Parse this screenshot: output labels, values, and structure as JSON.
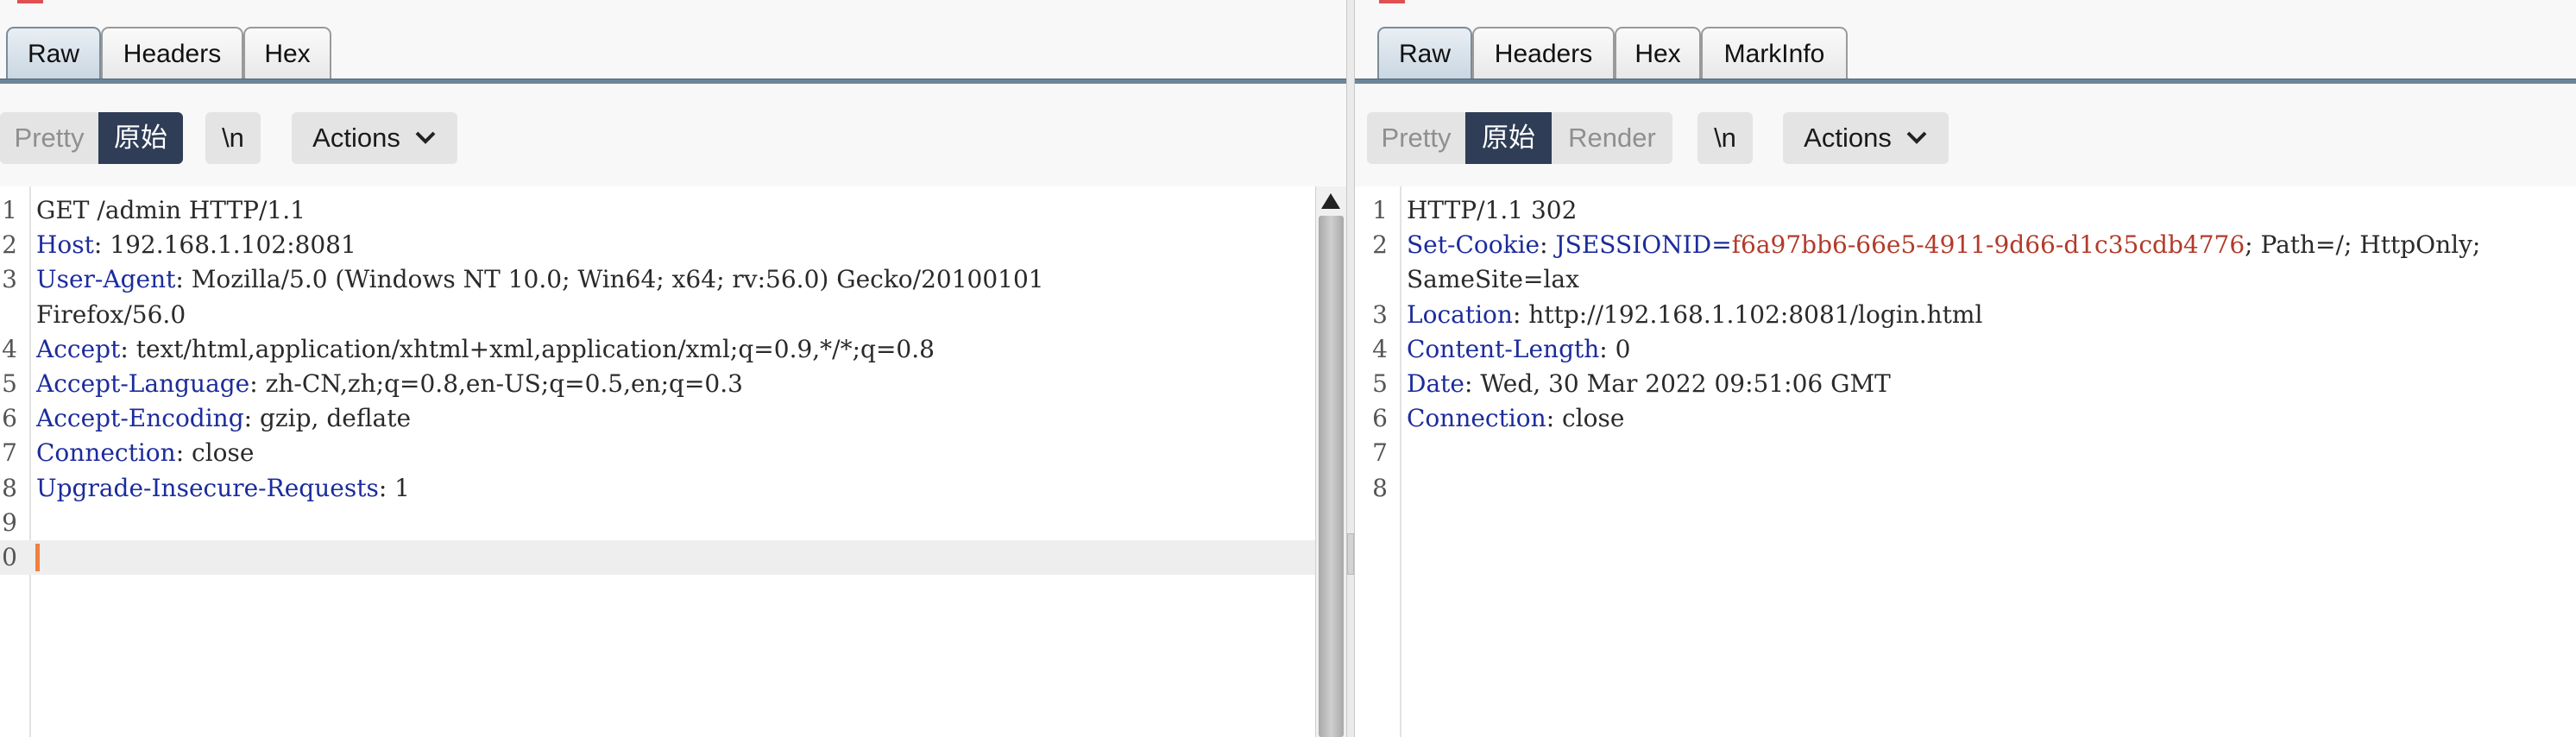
{
  "request": {
    "tabs": [
      {
        "label": "Raw",
        "active": true
      },
      {
        "label": "Headers",
        "active": false
      },
      {
        "label": "Hex",
        "active": false
      }
    ],
    "view_modes": [
      {
        "label": "Pretty",
        "active": false
      },
      {
        "label": "原始",
        "active": true
      }
    ],
    "newline_label": "\\n",
    "actions_label": "Actions",
    "lines": [
      {
        "num": "1",
        "key": "",
        "sep": "",
        "value": "GET /admin HTTP/1.1"
      },
      {
        "num": "2",
        "key": "Host",
        "sep": ": ",
        "value": "192.168.1.102:8081"
      },
      {
        "num": "3",
        "key": "User-Agent",
        "sep": ": ",
        "value": "Mozilla/5.0 (Windows NT 10.0; Win64; x64; rv:56.0) Gecko/20100101"
      },
      {
        "num": "",
        "key": "",
        "sep": "",
        "value": "Firefox/56.0"
      },
      {
        "num": "4",
        "key": "Accept",
        "sep": ": ",
        "value": "text/html,application/xhtml+xml,application/xml;q=0.9,*/*;q=0.8"
      },
      {
        "num": "5",
        "key": "Accept-Language",
        "sep": ": ",
        "value": "zh-CN,zh;q=0.8,en-US;q=0.5,en;q=0.3"
      },
      {
        "num": "6",
        "key": "Accept-Encoding",
        "sep": ": ",
        "value": "gzip, deflate"
      },
      {
        "num": "7",
        "key": "Connection",
        "sep": ": ",
        "value": "close"
      },
      {
        "num": "8",
        "key": "Upgrade-Insecure-Requests",
        "sep": ": ",
        "value": "1"
      },
      {
        "num": "9",
        "key": "",
        "sep": "",
        "value": ""
      },
      {
        "num": "0",
        "key": "",
        "sep": "",
        "value": ""
      }
    ]
  },
  "response": {
    "tabs": [
      {
        "label": "Raw",
        "active": true
      },
      {
        "label": "Headers",
        "active": false
      },
      {
        "label": "Hex",
        "active": false
      },
      {
        "label": "MarkInfo",
        "active": false
      }
    ],
    "view_modes": [
      {
        "label": "Pretty",
        "active": false
      },
      {
        "label": "原始",
        "active": true
      },
      {
        "label": "Render",
        "active": false
      }
    ],
    "newline_label": "\\n",
    "actions_label": "Actions",
    "lines": [
      {
        "num": "1",
        "key": "",
        "sep": "",
        "value": "HTTP/1.1 302"
      },
      {
        "num": "2",
        "key": "Set-Cookie",
        "sep": ": ",
        "cookie_name": "JSESSIONID",
        "cookie_eq": "=",
        "cookie_value": "f6a97bb6-66e5-4911-9d66-d1c35cdb4776",
        "value": "; Path=/; HttpOnly;"
      },
      {
        "num": "",
        "key": "",
        "sep": "",
        "value": "SameSite=lax"
      },
      {
        "num": "3",
        "key": "Location",
        "sep": ": ",
        "value": "http://192.168.1.102:8081/login.html"
      },
      {
        "num": "4",
        "key": "Content-Length",
        "sep": ": ",
        "value": "0"
      },
      {
        "num": "5",
        "key": "Date",
        "sep": ": ",
        "value": "Wed, 30 Mar 2022 09:51:06 GMT"
      },
      {
        "num": "6",
        "key": "Connection",
        "sep": ": ",
        "value": "close"
      },
      {
        "num": "7",
        "key": "",
        "sep": "",
        "value": ""
      },
      {
        "num": "8",
        "key": "",
        "sep": "",
        "value": ""
      }
    ]
  },
  "colors": {
    "header_key": "#1c2c9c",
    "cookie_value": "#b33a2a",
    "active_segment": "#2f3d56",
    "caret": "#f08040"
  },
  "icons": {
    "actions": "chevron-down-icon",
    "scroll": "scroll-up-arrow-icon"
  }
}
